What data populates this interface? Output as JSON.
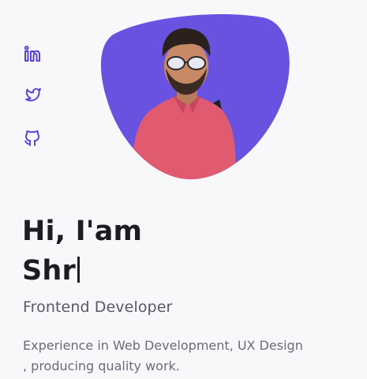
{
  "social": {
    "links": [
      {
        "icon": "linkedin-icon"
      },
      {
        "icon": "twitter-icon"
      },
      {
        "icon": "github-icon"
      }
    ],
    "icon_color": "#5b3fd6"
  },
  "hero": {
    "greeting": "Hi, I'am",
    "name_typed": "Shr",
    "role": "Frontend Developer",
    "description": "Experience in Web Development, UX Design , producing quality work.",
    "blob_color": "#6a52e0"
  }
}
